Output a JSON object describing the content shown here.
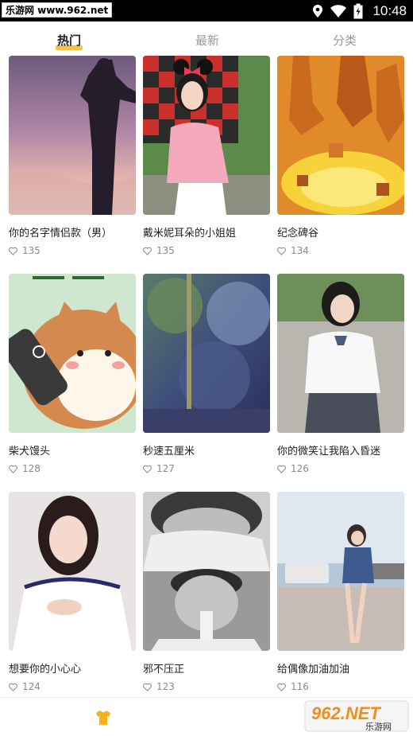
{
  "status_bar": {
    "watermark_text": "乐游网 www.962.net",
    "time": "10:48"
  },
  "tabs": [
    {
      "label": "热门",
      "active": true
    },
    {
      "label": "最新",
      "active": false
    },
    {
      "label": "分类",
      "active": false
    }
  ],
  "cards": [
    {
      "title": "你的名字情侣款（男）",
      "likes": "135"
    },
    {
      "title": "戴米妮耳朵的小姐姐",
      "likes": "135"
    },
    {
      "title": "纪念碑谷",
      "likes": "134"
    },
    {
      "title": "柴犬馒头",
      "likes": "128"
    },
    {
      "title": "秒速五厘米",
      "likes": "127"
    },
    {
      "title": "你的微笑让我陷入昏迷",
      "likes": "126"
    },
    {
      "title": "想要你的小心心",
      "likes": "124"
    },
    {
      "title": "邪不压正",
      "likes": "123"
    },
    {
      "title": "给偶像加油加油",
      "likes": "116"
    }
  ],
  "watermark_logo": {
    "brand": "962.NET",
    "sub": "乐游网"
  },
  "colors": {
    "accent": "#f6c344",
    "tab_inactive": "#9a9a9a"
  }
}
